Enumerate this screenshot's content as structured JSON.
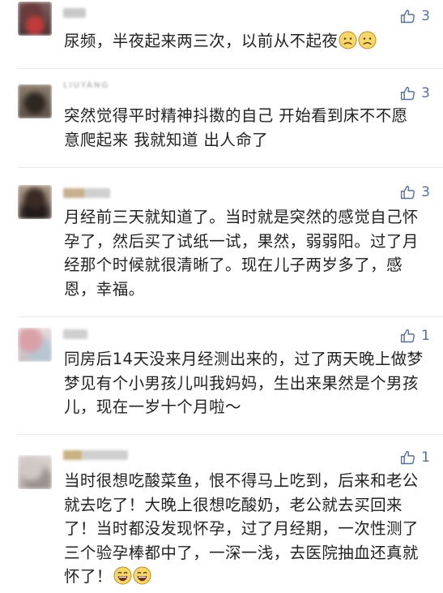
{
  "comments": [
    {
      "author": "",
      "likes": "3",
      "text": "尿频，半夜起来两三次，以前从不起夜"
    },
    {
      "author": "LIUYANG",
      "likes": "3",
      "text": "突然觉得平时精神抖擞的自己 开始看到床不不愿意爬起来 我就知道 出人命了"
    },
    {
      "author": "",
      "likes": "3",
      "text": "月经前三天就知道了。当时就是突然的感觉自己怀孕了，然后买了试纸一试，果然，弱弱阳。过了月经那个时候就很清晰了。现在儿子两岁多了，感恩，幸福。"
    },
    {
      "author": "",
      "likes": "1",
      "text": "同房后14天没来月经测出来的，过了两天晚上做梦梦见有个小男孩儿叫我妈妈，生出来果然是个男孩儿，现在一岁十个月啦～"
    },
    {
      "author": "",
      "likes": "1",
      "text": "当时很想吃酸菜鱼，恨不得马上吃到，后来和老公就去吃了！大晚上很想吃酸奶，老公就去买回来了！当时都没发现怀孕，过了月经期，一次性测了三个验孕棒都中了，一深一浅，去医院抽血还真就怀了！"
    }
  ],
  "icons": {
    "like": "thumbs-up-outline-icon",
    "emoji_sad": "worried-face-emoji",
    "emoji_laugh": "grinning-face-emoji"
  },
  "colors": {
    "like_accent": "#56709a",
    "text": "#222222",
    "divider": "#e9e9e9"
  }
}
